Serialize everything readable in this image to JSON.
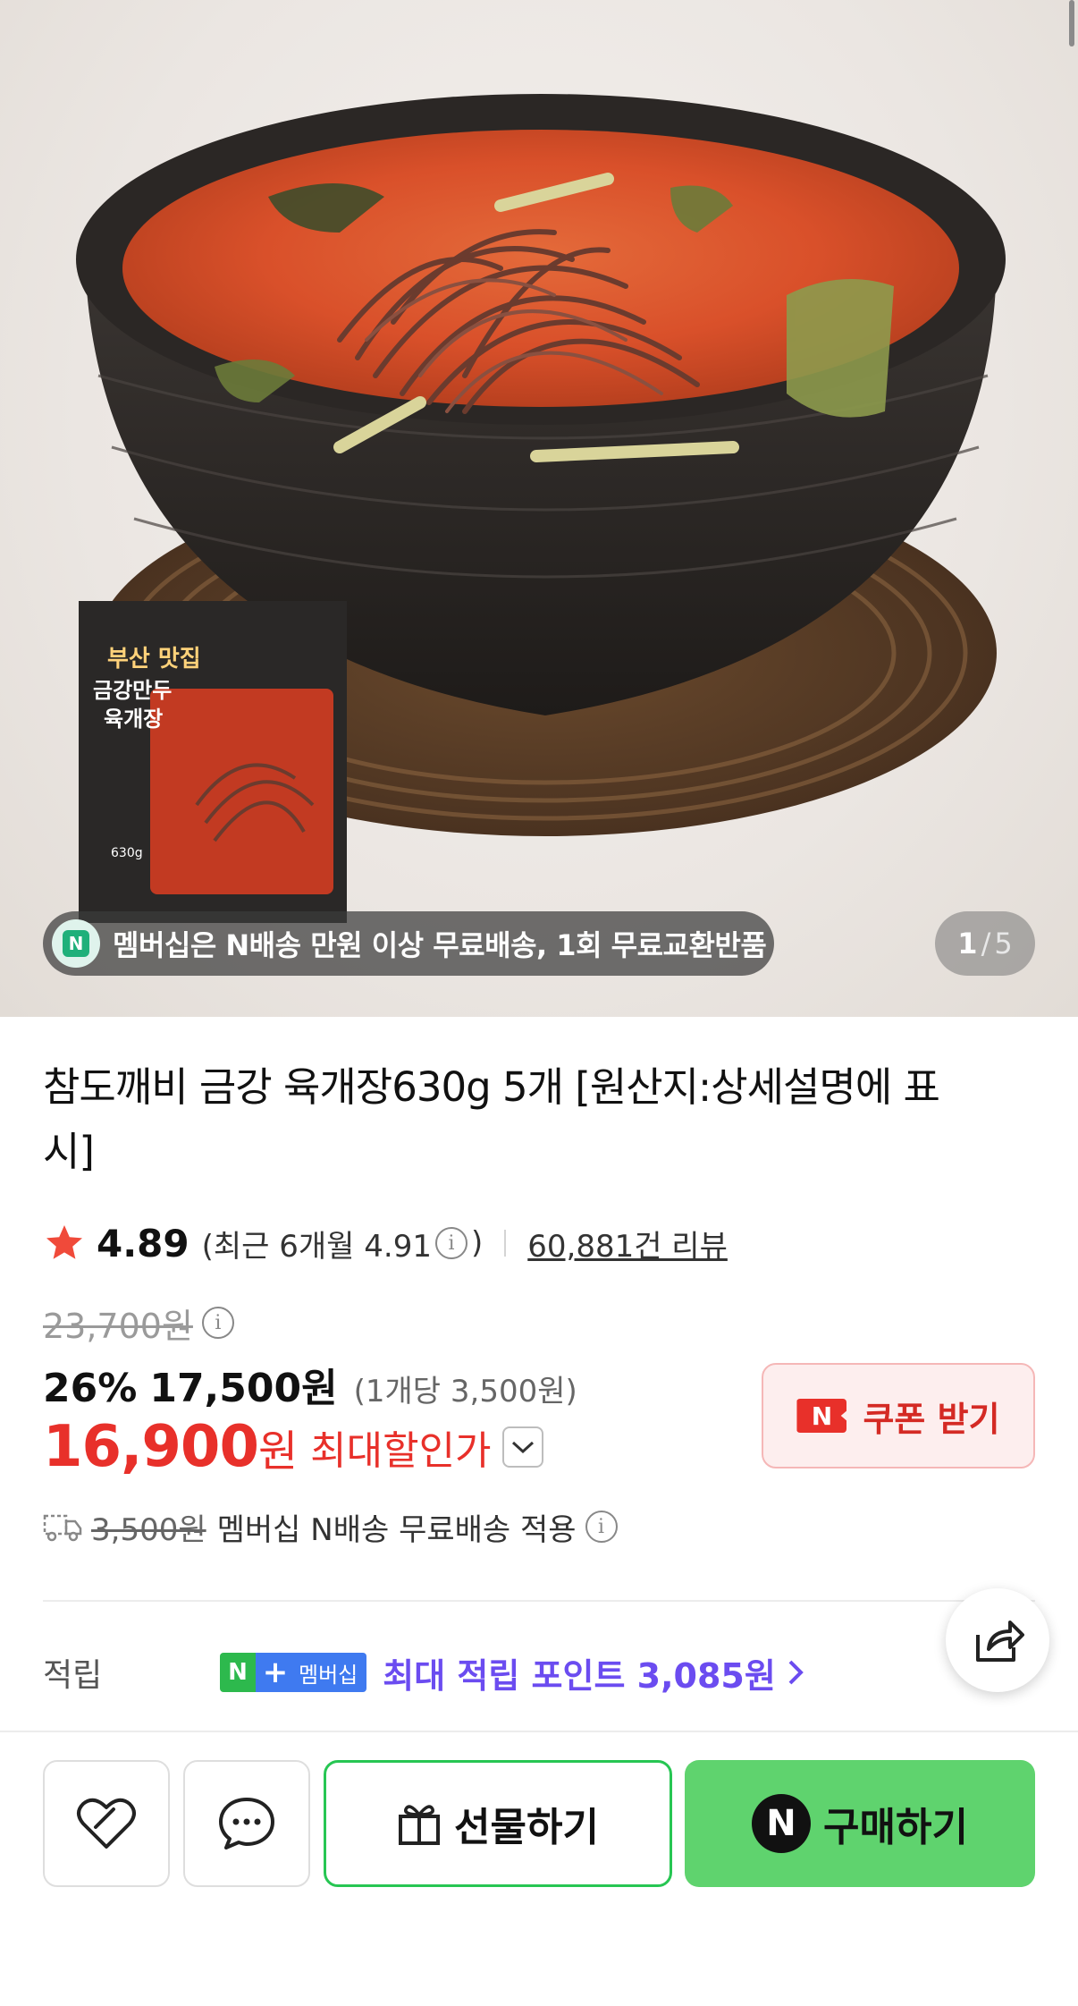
{
  "hero": {
    "membership_text": "멤버십은 N배송 만원 이상 무료배송, 1회 무료교환반품",
    "membership_badge": "N",
    "counter_current": "1",
    "counter_separator": "/",
    "counter_total": "5",
    "package_label": "부산 맛집 금강만두 육개장",
    "package_weight": "630g"
  },
  "product": {
    "title": "참도깨비 금강 육개장630g 5개 [원산지:상세설명에 표시]"
  },
  "rating": {
    "score": "4.89",
    "recent": "(최근 6개월 4.91",
    "recent_close": ")",
    "reviews": "60,881건 리뷰",
    "star_color": "#f04a3a"
  },
  "price": {
    "original": "23,700원",
    "discount_rate": "26%",
    "sale_price": "17,500원",
    "per_unit": "(1개당 3,500원)",
    "max_discount_price": "16,900",
    "max_discount_won": "원",
    "max_discount_label": "최대할인가",
    "accent_color": "#e8302a"
  },
  "coupon": {
    "badge": "N",
    "label": "쿠폰 받기"
  },
  "shipping": {
    "original_fee": "3,500원",
    "text": "멤버십 N배송 무료배송 적용"
  },
  "points": {
    "label": "적립",
    "badge_n": "N",
    "badge_plus": "+",
    "badge_membership": "멤버십",
    "text": "최대 적립 포인트 3,085원",
    "color": "#6b4cf0"
  },
  "actions": {
    "gift_label": "선물하기",
    "buy_badge": "N",
    "buy_label": "구매하기",
    "buy_color": "#5fd36e",
    "icons": [
      "heart-icon",
      "chat-icon",
      "gift-icon",
      "share-icon"
    ]
  }
}
